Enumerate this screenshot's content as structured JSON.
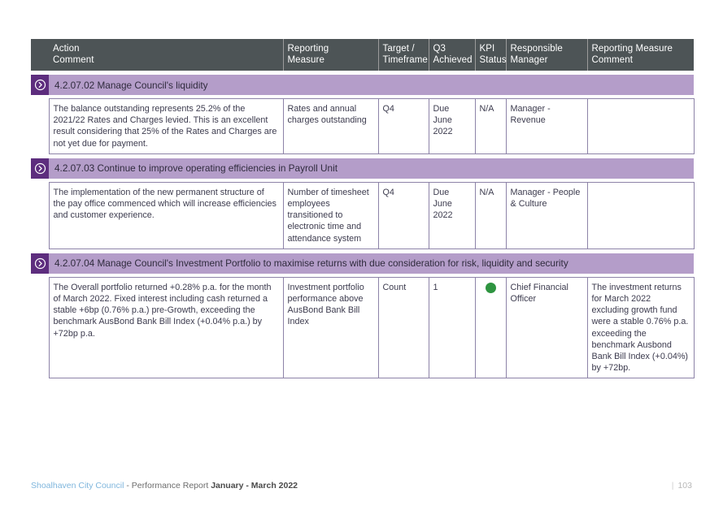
{
  "table": {
    "columns": [
      {
        "id": "action",
        "line1": "Action",
        "line2": "Comment"
      },
      {
        "id": "measure",
        "line1": "Reporting",
        "line2": "Measure"
      },
      {
        "id": "target",
        "line1": "Target /",
        "line2": "Timeframe"
      },
      {
        "id": "q3",
        "line1": "Q3",
        "line2": "Achieved"
      },
      {
        "id": "kpi",
        "line1": "KPI",
        "line2": "Status"
      },
      {
        "id": "resp",
        "line1": "Responsible",
        "line2": "Manager"
      },
      {
        "id": "rmc",
        "line1": "Reporting Measure",
        "line2": "Comment"
      }
    ],
    "sections": [
      {
        "badge_icon": "chevron-right-circle-icon",
        "title": "4.2.07.02 Manage Council's liquidity",
        "row": {
          "action_comment": "The balance outstanding represents 25.2% of the 2021/22 Rates and Charges levied. This is an excellent result considering that 25% of the Rates and Charges are not yet due for payment.",
          "reporting_measure": "Rates and annual charges outstanding",
          "target_timeframe": "Q4",
          "q3_achieved": "Due June 2022",
          "kpi_status": "N/A",
          "kpi_status_type": "text",
          "responsible_manager": "Manager - Revenue",
          "reporting_measure_comment": ""
        }
      },
      {
        "badge_icon": "chevron-right-circle-icon",
        "title": "4.2.07.03 Continue to improve operating efficiencies in Payroll Unit",
        "row": {
          "action_comment": "The implementation of  the new permanent structure of the pay office commenced which will increase efficiencies and customer experience.",
          "reporting_measure": "Number of timesheet employees transitioned to electronic time and attendance system",
          "target_timeframe": "Q4",
          "q3_achieved": "Due June 2022",
          "kpi_status": "N/A",
          "kpi_status_type": "text",
          "responsible_manager": "Manager - People & Culture",
          "reporting_measure_comment": ""
        }
      },
      {
        "badge_icon": "chevron-right-circle-icon",
        "title": "4.2.07.04 Manage Council's Investment Portfolio to maximise returns with due consideration for risk, liquidity and security",
        "row": {
          "action_comment": "The Overall portfolio returned +0.28% p.a. for the month of March 2022. Fixed interest including cash returned a stable +6bp (0.76% p.a.) pre-Growth, exceeding the benchmark AusBond Bank Bill Index (+0.04% p.a.) by +72bp p.a.",
          "reporting_measure": "Investment portfolio performance above AusBond Bank Bill Index",
          "target_timeframe": "Count",
          "q3_achieved": "1",
          "kpi_status": "green-status-dot",
          "kpi_status_type": "dot",
          "responsible_manager": "Chief Financial Officer",
          "reporting_measure_comment": "The investment returns for March 2022 excluding growth fund were a stable 0.76% p.a. exceeding the benchmark Ausbond Bank Bill Index (+0.04%) by +72bp."
        }
      }
    ]
  },
  "footer": {
    "council": "Shoalhaven City Council",
    "report": " - Performance Report ",
    "period": "January - March 2022",
    "page_separator": "|",
    "page_number": "103"
  },
  "colors": {
    "header_bg": "#4d5456",
    "band_bg": "#b49dc9",
    "badge_bg": "#5d2d7e",
    "cell_border": "#8d83a8",
    "status_green": "#2e9440",
    "footer_accent": "#7fb6dd"
  }
}
